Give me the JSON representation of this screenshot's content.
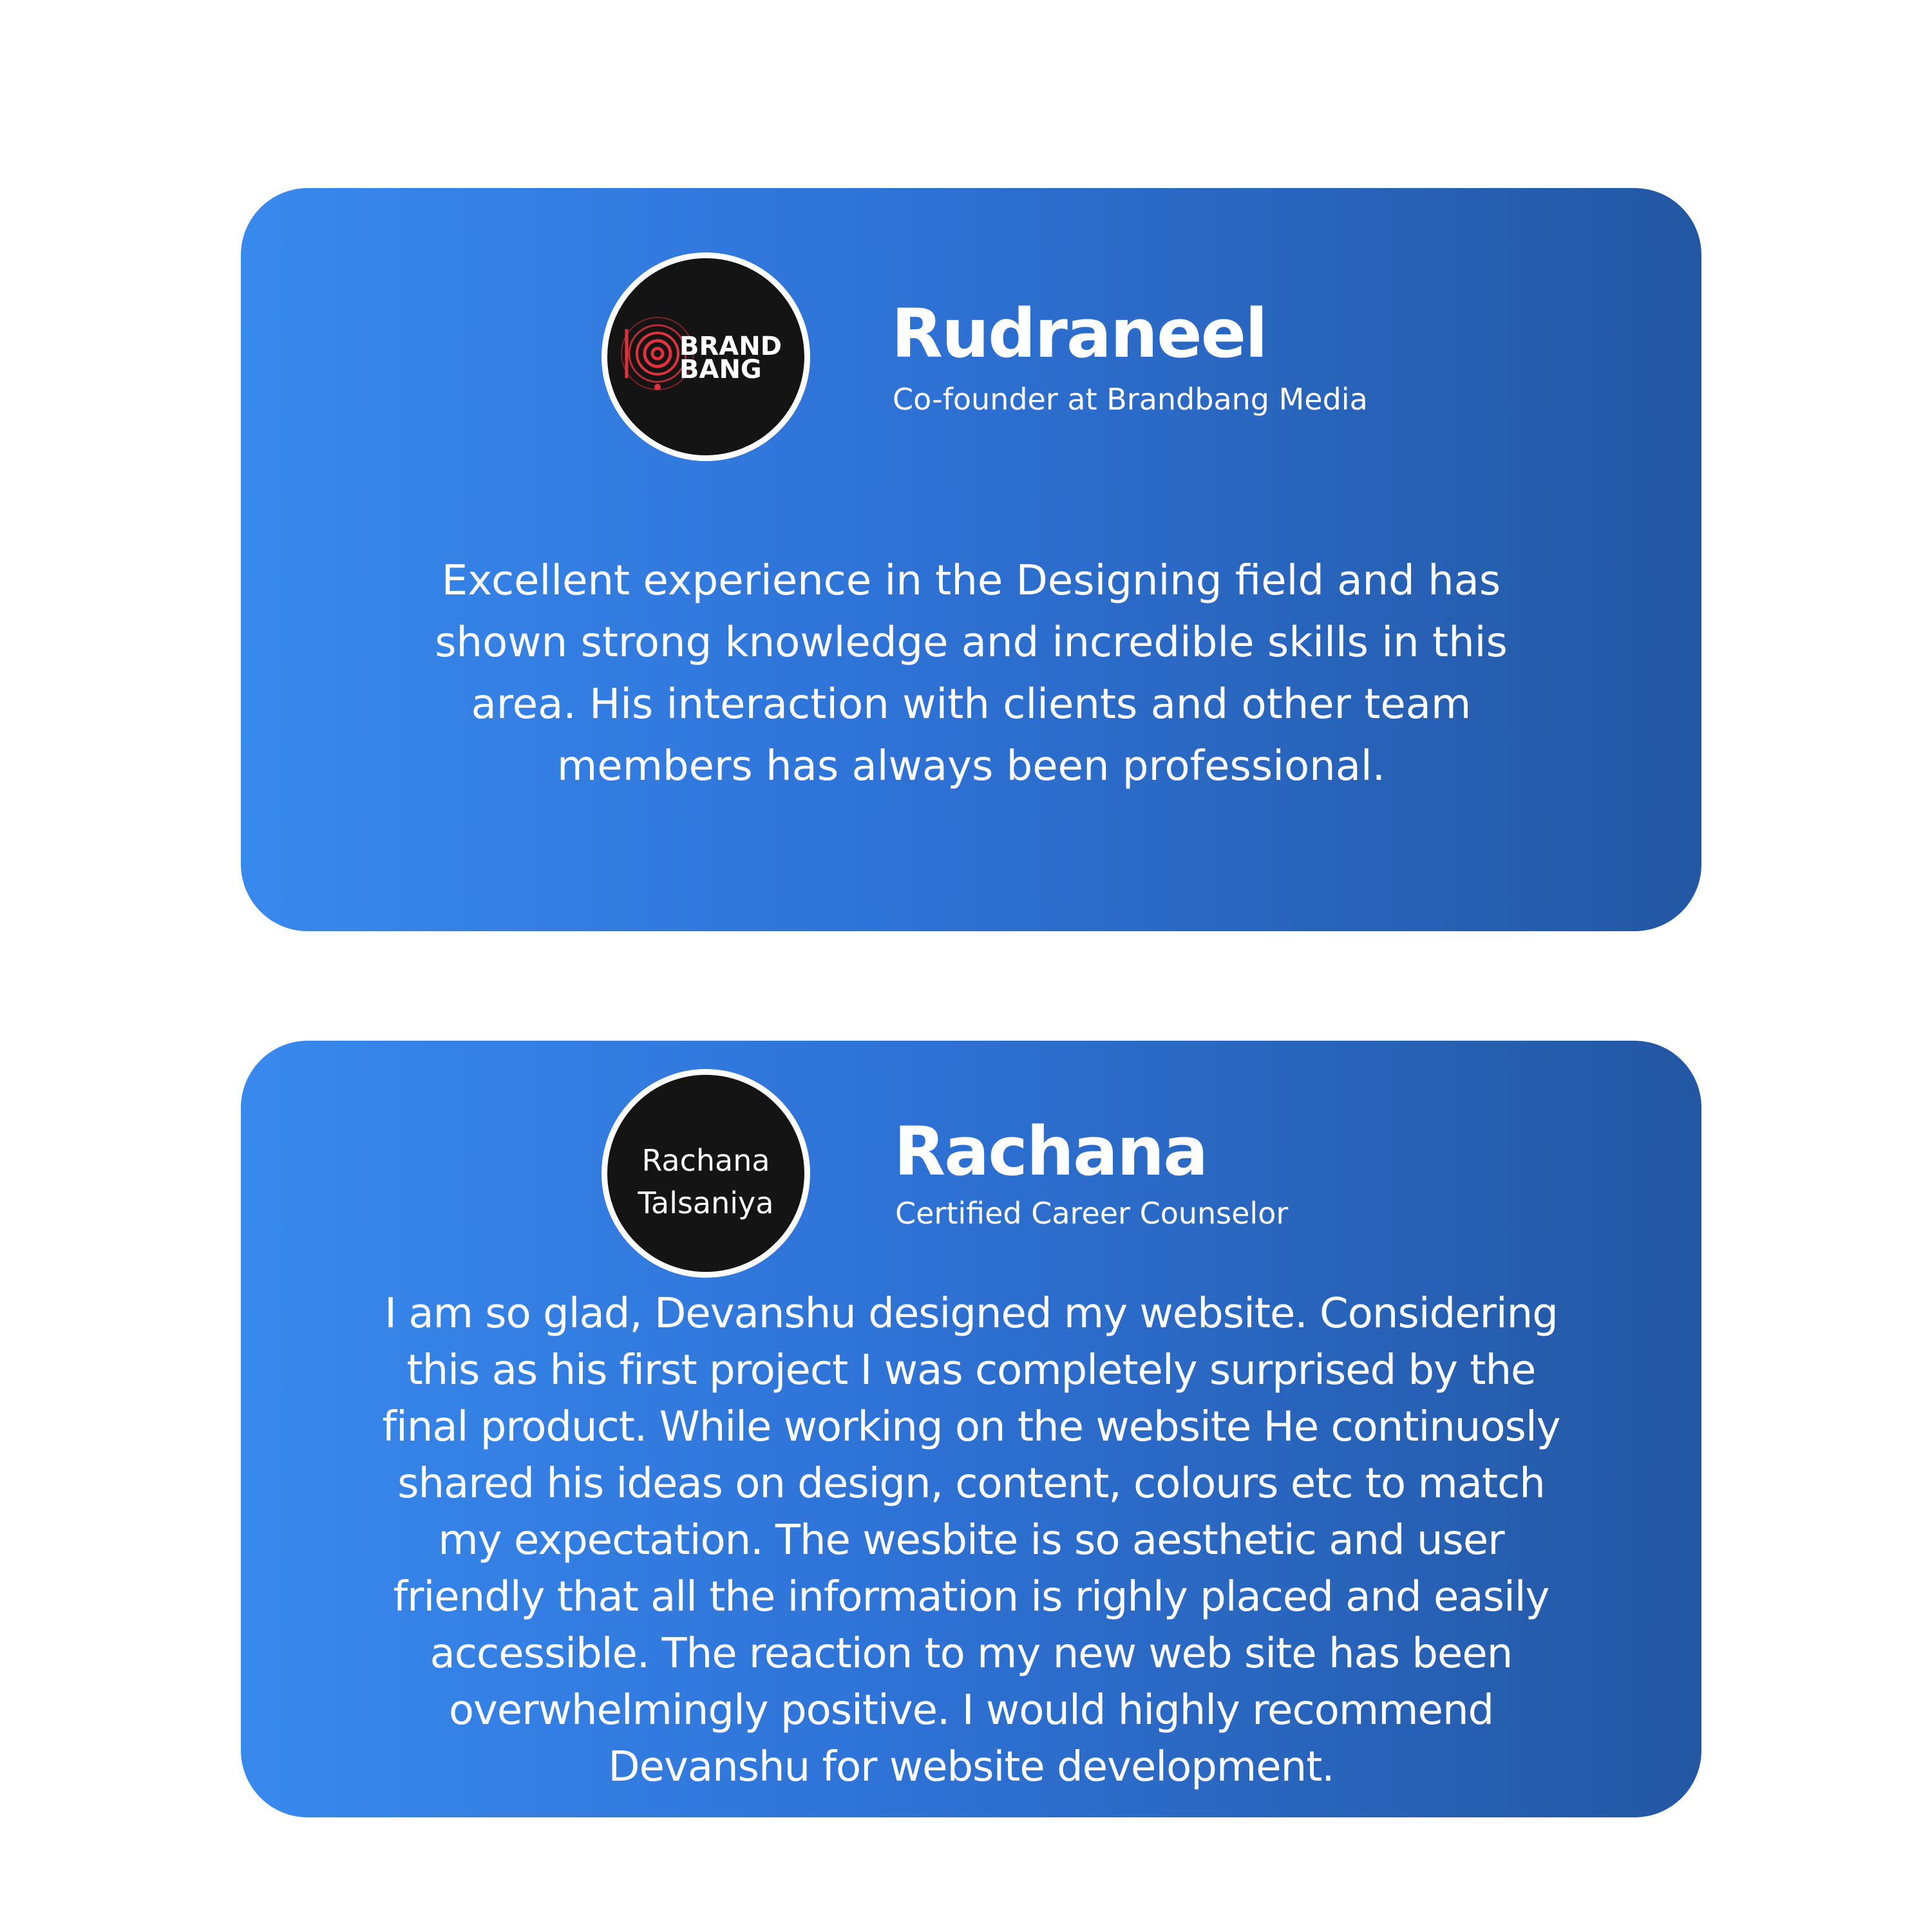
{
  "testimonials": [
    {
      "avatar": {
        "type": "logo",
        "logo_words": [
          "BRAND",
          "BANG"
        ],
        "icon": "brandbang-logo-icon",
        "accent_color": "#e0313d"
      },
      "name": "Rudraneel",
      "role": "Co-founder at Brandbang Media",
      "quote": "Excellent experience in the Designing field and has\nshown strong knowledge and incredible skills in this\narea. His interaction with clients and other team\nmembers has always been professional."
    },
    {
      "avatar": {
        "type": "text",
        "lines": [
          "Rachana",
          "Talsaniya"
        ]
      },
      "name": "Rachana",
      "role": "Certified Career Counselor",
      "quote": "I am so glad, Devanshu designed my website. Considering\nthis as his first project I was completely surprised by the\nfinal product. While working on the website He continuosly\nshared his ideas on design, content, colours etc  to match\nmy expectation. The wesbite is so aesthetic and user\nfriendly that all the information is righly placed and easily\naccessible. The reaction to my new web site has been\noverwhelmingly positive. I would highly recommend\nDevanshu for website development."
    }
  ],
  "colors": {
    "card_gradient_start": "#3889ee",
    "card_gradient_end": "#2357a3",
    "avatar_bg": "#141414",
    "text": "#ffffff"
  }
}
